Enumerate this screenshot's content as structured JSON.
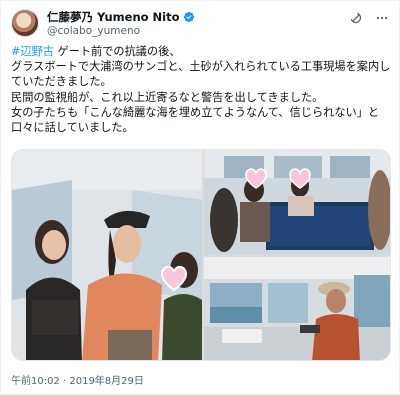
{
  "tweet": {
    "author": {
      "display_name": "仁藤夢乃 Yumeno Nito",
      "handle": "@colabo_yumeno",
      "verified": true
    },
    "header_icons": [
      "grok-icon",
      "more-icon"
    ],
    "text_hashtag": "#辺野古",
    "text_line1_rest": " ゲート前での抗議の後、",
    "text_body": "グラスボートで大浦湾のサンゴと、土砂が入れられている工事現場を案内していただきました。\n民間の監視船が、これ以上近寄るなと警告を出してきました。\n女の子たちも「こんな綺麗な海を埋め立てようなんて、信じられない」と口々に話していました。",
    "media_count": 3,
    "timestamp": "午前10:02 · 2019年8月29日"
  },
  "colors": {
    "link": "#1d9bf0",
    "verified": "#1d9bf0",
    "secondary_text": "#536471"
  }
}
